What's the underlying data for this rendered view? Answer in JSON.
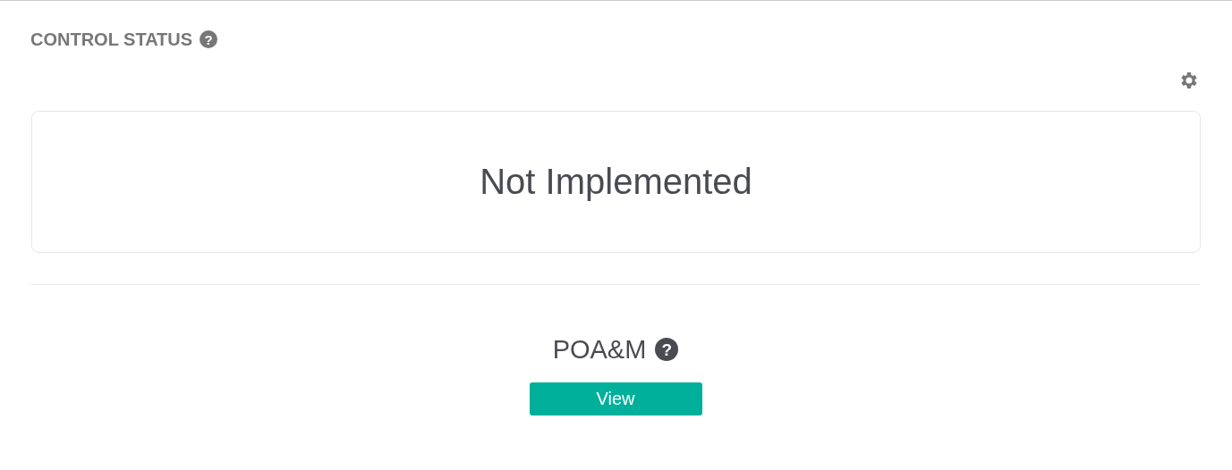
{
  "panel": {
    "title": "CONTROL STATUS",
    "help": "?"
  },
  "status": {
    "text": "Not Implemented"
  },
  "poam": {
    "title": "POA&M",
    "help": "?",
    "button": "View"
  }
}
